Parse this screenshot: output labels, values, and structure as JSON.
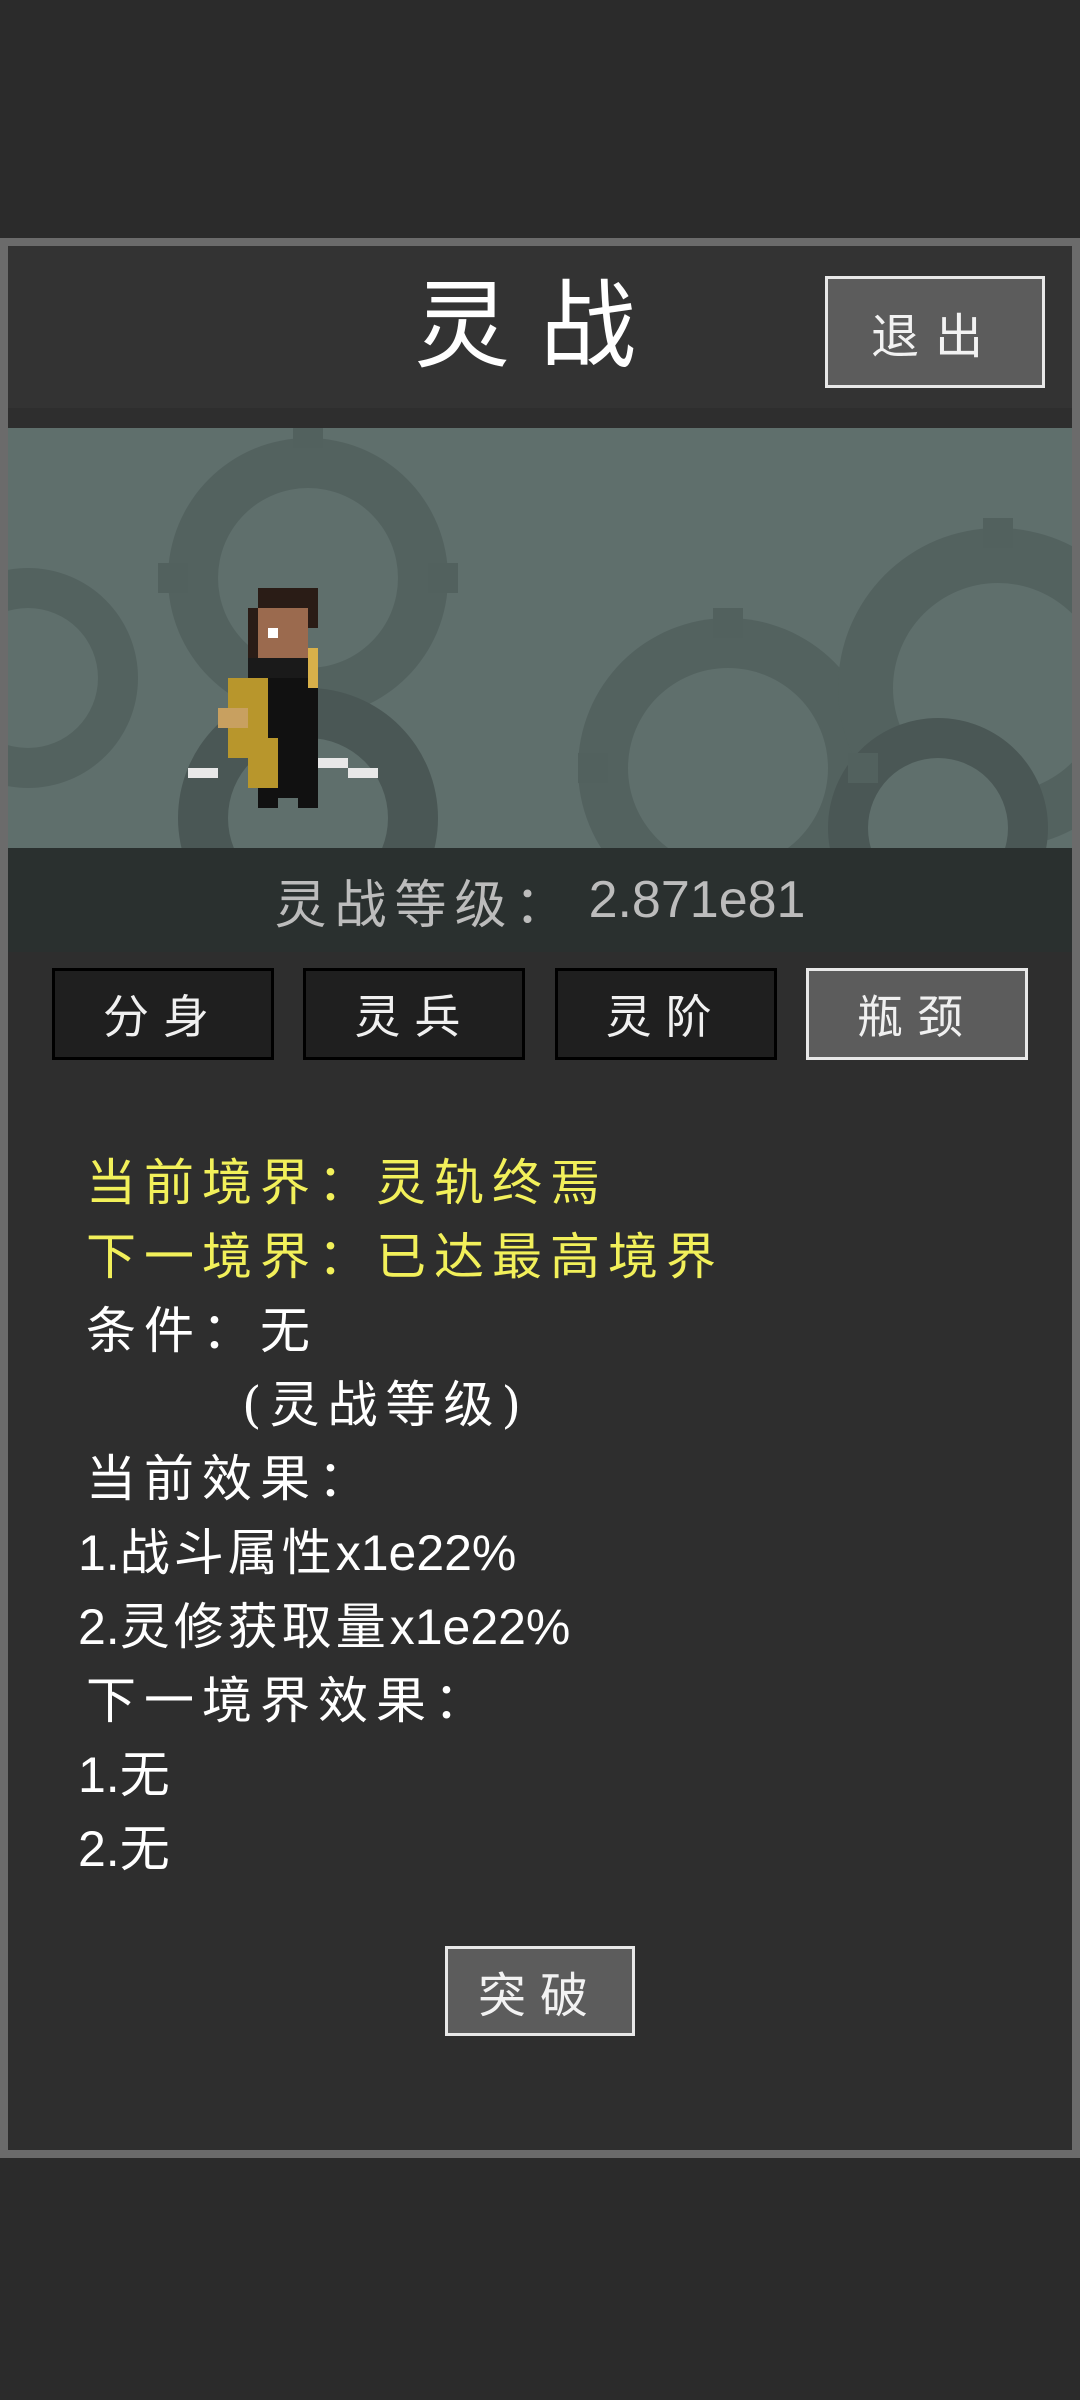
{
  "header": {
    "title": "灵战",
    "exit_label": "退出"
  },
  "level": {
    "label": "灵战等级：",
    "value": "2.871e81"
  },
  "tabs": [
    {
      "label": "分身",
      "active": false
    },
    {
      "label": "灵兵",
      "active": false
    },
    {
      "label": "灵阶",
      "active": false
    },
    {
      "label": "瓶颈",
      "active": true
    }
  ],
  "realm": {
    "current_label": "当前境界：",
    "current_value": "灵轨终焉",
    "next_label": "下一境界：",
    "next_value": "已达最高境界",
    "condition_label": "条件：",
    "condition_value": "无",
    "condition_note": "(灵战等级)",
    "current_effects_label": "当前效果：",
    "current_effects": [
      {
        "index": "1.",
        "text": "战斗属性",
        "value": "x1e22%"
      },
      {
        "index": "2.",
        "text": "灵修获取量",
        "value": "x1e22%"
      }
    ],
    "next_effects_label": "下一境界效果：",
    "next_effects": [
      {
        "index": "1.",
        "text": "无"
      },
      {
        "index": "2.",
        "text": "无"
      }
    ]
  },
  "breakthrough_label": "突破",
  "colors": {
    "highlight": "#f2f05a",
    "background": "#2b2b2b",
    "banner": "#5f6f6c"
  }
}
